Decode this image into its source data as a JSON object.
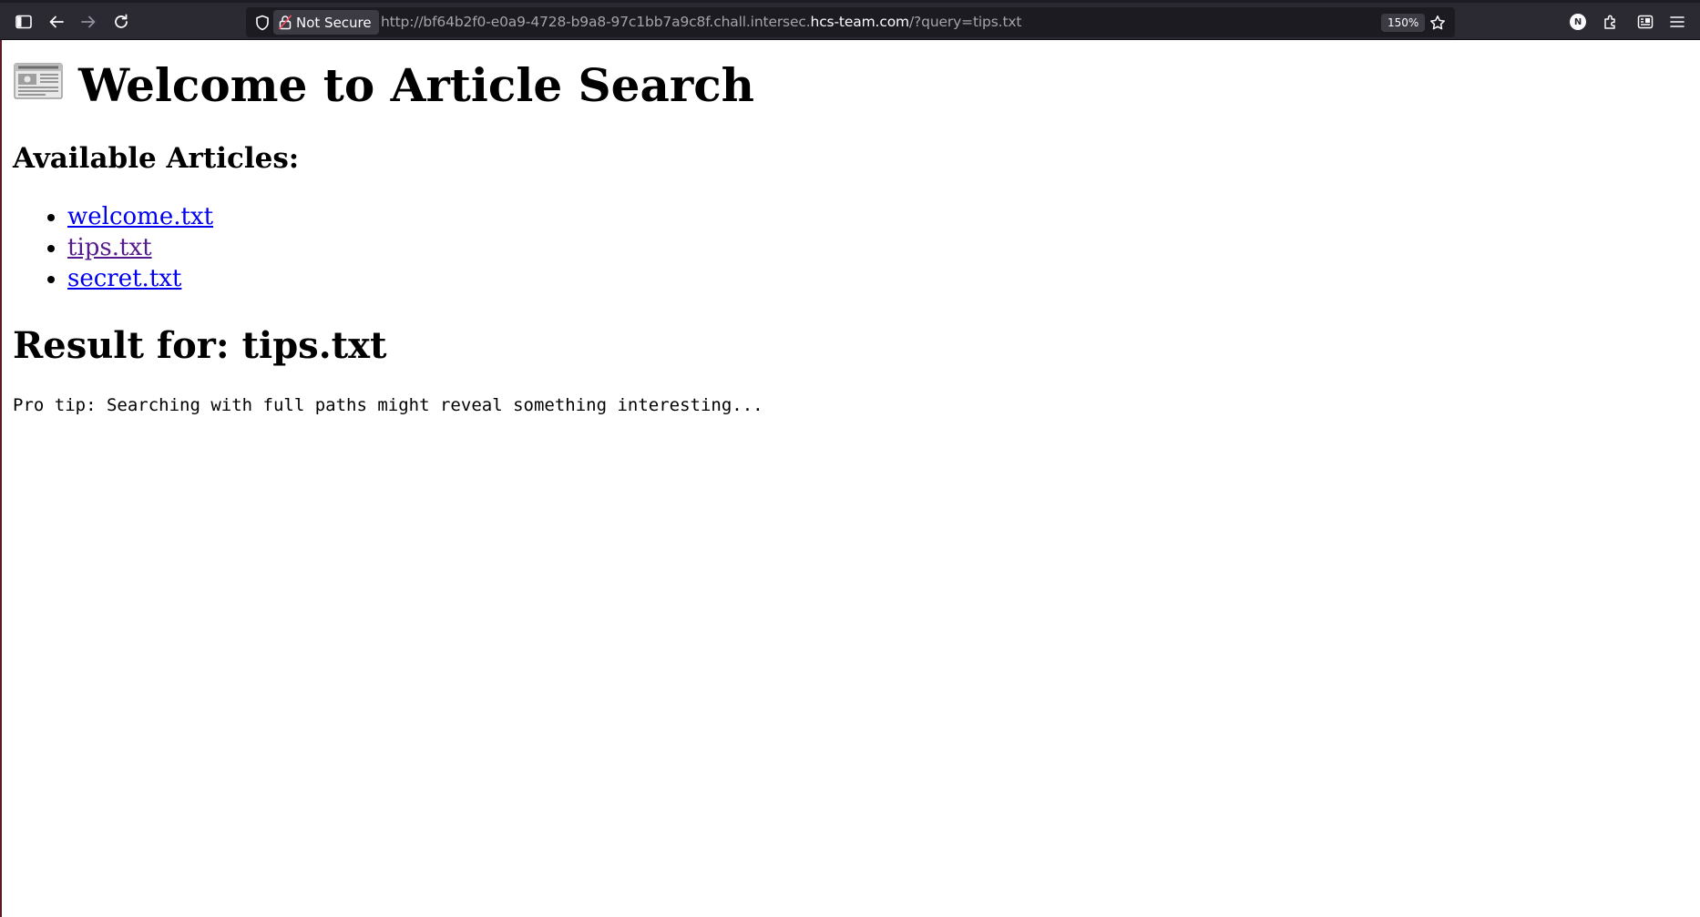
{
  "browser": {
    "security_label": "Not Secure",
    "url_prefix": "http://bf64b2f0-e0a9-4728-b9a8-97c1bb7a9c8f.chall.intersec.",
    "url_domain": "hcs-team.com",
    "url_suffix": "/?query=tips.txt",
    "zoom": "150%",
    "profile_initial": "N",
    "icons": {
      "sidebar": "sidebar-icon",
      "back": "back-arrow-icon",
      "forward": "forward-arrow-icon",
      "reload": "reload-icon",
      "shield": "shield-icon",
      "lock": "insecure-lock-icon",
      "bookmark": "star-icon",
      "extensions": "puzzle-icon",
      "menu": "hamburger-icon"
    }
  },
  "page": {
    "title_emoji_icon": "newspaper-icon",
    "title": "Welcome to Article Search",
    "articles_heading": "Available Articles:",
    "articles": [
      {
        "label": "welcome.txt",
        "visited": false
      },
      {
        "label": "tips.txt",
        "visited": true
      },
      {
        "label": "secret.txt",
        "visited": false
      }
    ],
    "result_heading": "Result for: tips.txt",
    "result_text": "Pro tip: Searching with full paths might reveal something interesting...",
    "colors": {
      "link": "#0000ee",
      "visited_link": "#551a8b",
      "toolbar": "#2b2a33"
    }
  }
}
